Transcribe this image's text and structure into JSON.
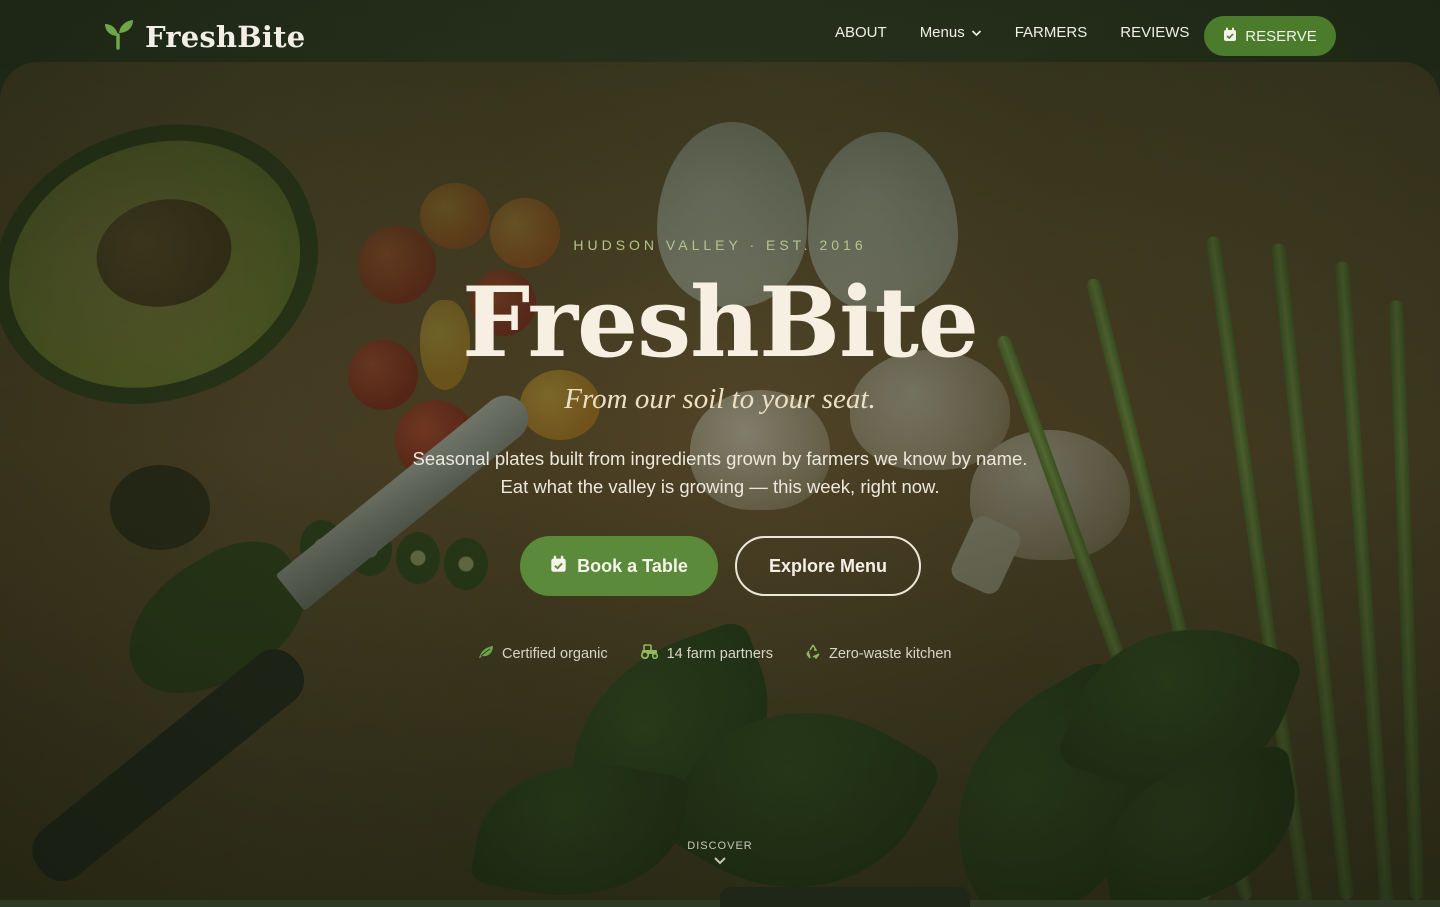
{
  "brand": {
    "name": "FreshBite",
    "icon": "sprout-icon"
  },
  "nav": {
    "links": [
      {
        "label": "ABOUT"
      },
      {
        "label": "Menus",
        "has_dropdown": true
      },
      {
        "label": "FARMERS"
      },
      {
        "label": "REVIEWS"
      }
    ],
    "reserve_label": "RESERVE"
  },
  "hero": {
    "eyebrow": "HUDSON VALLEY · EST. 2016",
    "title": "FreshBite",
    "tagline": "From our soil to your seat.",
    "description_line1": "Seasonal plates built from ingredients grown by farmers we know by name.",
    "description_line2": "Eat what the valley is growing — this week, right now.",
    "primary_cta": "Book a Table",
    "secondary_cta": "Explore Menu",
    "features": [
      {
        "icon": "leaf-icon",
        "label": "Certified organic"
      },
      {
        "icon": "tractor-icon",
        "label": "14 farm partners"
      },
      {
        "icon": "recycle-icon",
        "label": "Zero-waste kitchen"
      }
    ],
    "discover_label": "DISCOVER"
  },
  "colors": {
    "accent_green": "#5a8a3a",
    "reserve_green": "#4a7c2b",
    "eyebrow_green": "#b5c48c",
    "cream": "#f6efe2"
  }
}
